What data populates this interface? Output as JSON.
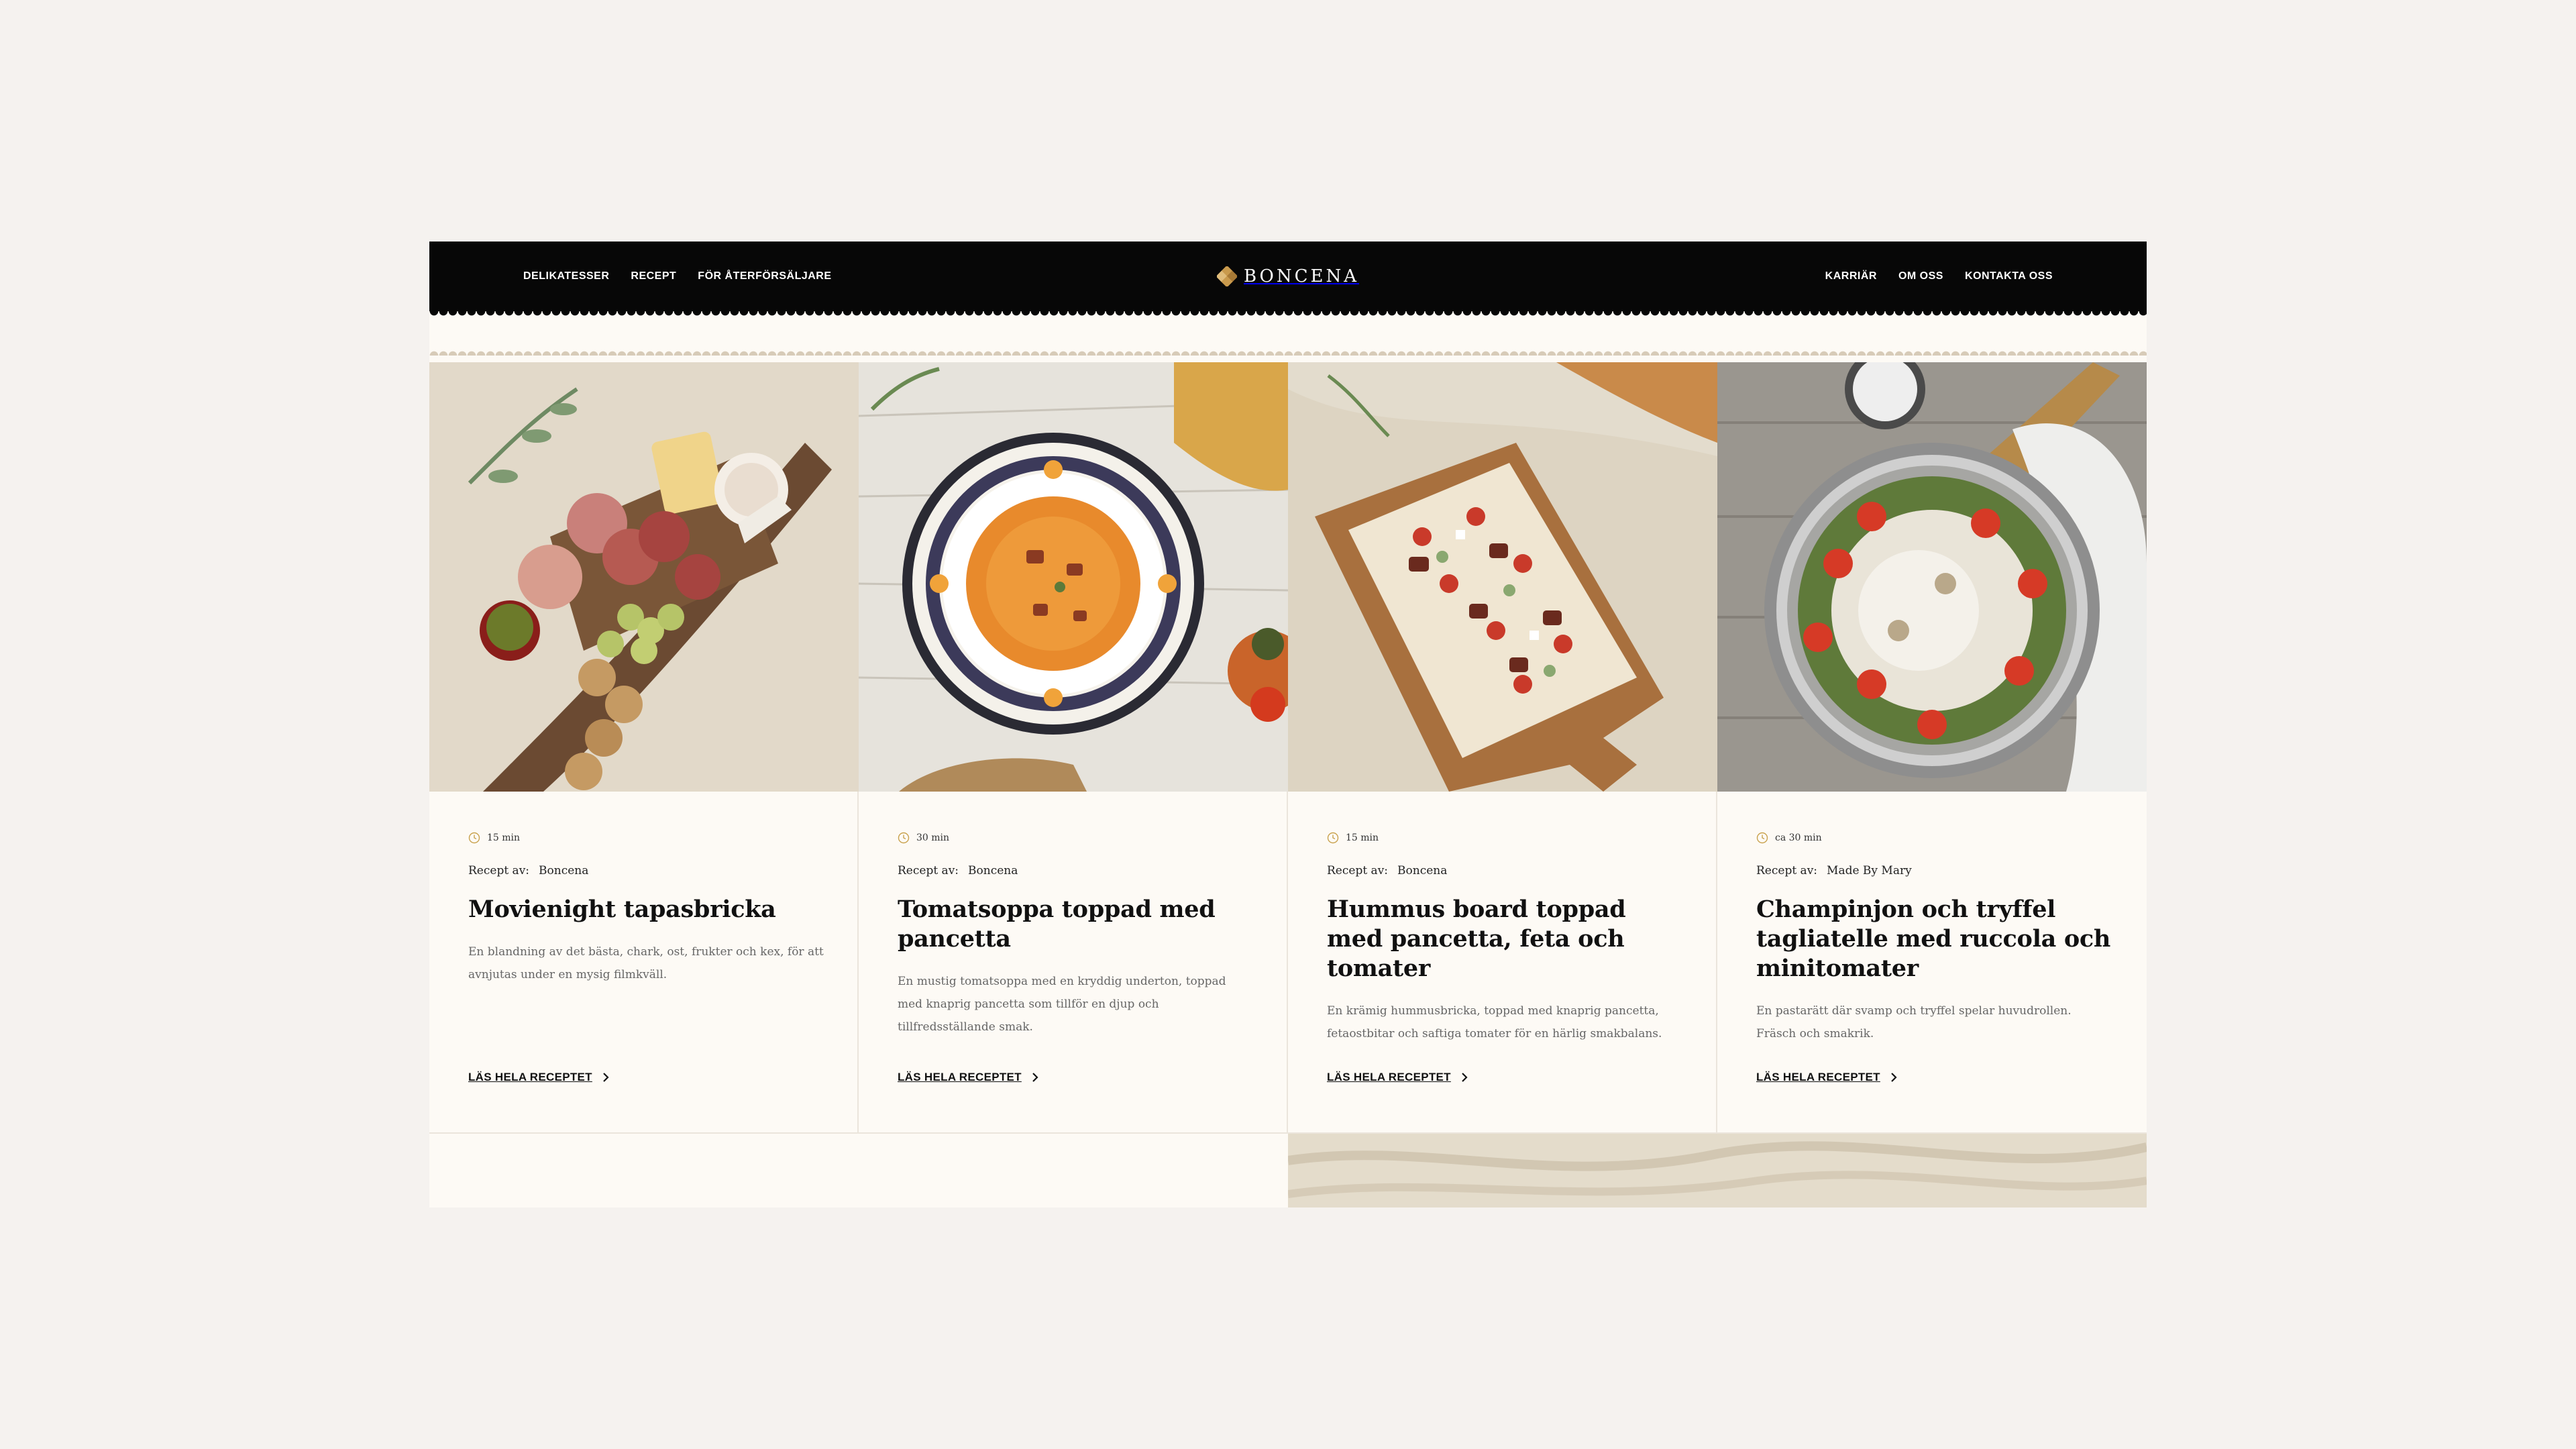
{
  "header": {
    "nav_left": [
      "DELIKATESSER",
      "RECEPT",
      "FÖR ÅTERFÖRSÄLJARE"
    ],
    "brand": "BONCENA",
    "nav_right": [
      "KARRIÄR",
      "OM OSS",
      "KONTAKTA OSS"
    ]
  },
  "colors": {
    "header_bg": "#070707",
    "page_bg": "#f5f2ef",
    "card_bg": "#fdfaf5",
    "logo_accent": "#c99a4d"
  },
  "cards": [
    {
      "time": "15 min",
      "author_label": "Recept av:",
      "author": "Boncena",
      "title": "Movienight tapasbricka",
      "description": "En blandning av det bästa, chark, ost, frukter och kex, för att avnjutas under en mysig filmkväll.",
      "cta": "LÄS HELA RECEPTET",
      "photo_icon": "charcuterie-board-photo"
    },
    {
      "time": "30 min",
      "author_label": "Recept av:",
      "author": "Boncena",
      "title": "Tomatsoppa toppad med pancetta",
      "description": "En mustig tomatsoppa med en kryddig underton, toppad med knaprig pancetta som tillför en djup och tillfredsställande smak.",
      "cta": "LÄS HELA RECEPTET",
      "photo_icon": "tomato-soup-photo"
    },
    {
      "time": "15 min",
      "author_label": "Recept av:",
      "author": "Boncena",
      "title": "Hummus board toppad med pancetta, feta och tomater",
      "description": "En krämig hummusbricka, toppad med knaprig pancetta, fetaostbitar och saftiga tomater för en härlig smakbalans.",
      "cta": "LÄS HELA RECEPTET",
      "photo_icon": "hummus-board-photo"
    },
    {
      "time": "ca 30 min",
      "author_label": "Recept av:",
      "author": "Made By Mary",
      "title": "Champinjon och tryffel tagliatelle med ruccola och minitomater",
      "description": "En pastarätt där svamp och tryffel spelar huvudrollen. Fräsch och smakrik.",
      "cta": "LÄS HELA RECEPTET",
      "photo_icon": "pasta-pan-photo"
    }
  ]
}
